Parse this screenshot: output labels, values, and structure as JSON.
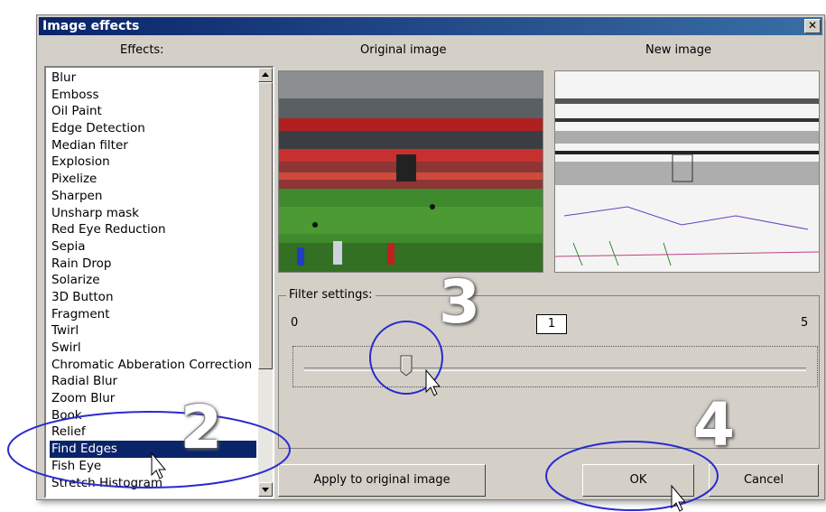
{
  "window": {
    "title": "Image effects"
  },
  "labels": {
    "effects": "Effects:",
    "original": "Original image",
    "new_image": "New image"
  },
  "effects_list": [
    "Blur",
    "Emboss",
    "Oil Paint",
    "Edge Detection",
    "Median filter",
    "Explosion",
    "Pixelize",
    "Sharpen",
    "Unsharp mask",
    "Red Eye Reduction",
    "Sepia",
    "Rain Drop",
    "Solarize",
    "3D Button",
    "Fragment",
    "Twirl",
    "Swirl",
    "Chromatic Abberation Correction",
    "Radial Blur",
    "Zoom Blur",
    "Book",
    "Relief",
    "Find Edges",
    "Fish Eye",
    "Stretch Histogram"
  ],
  "selected_effect": "Find Edges",
  "filter": {
    "legend": "Filter settings:",
    "min": "0",
    "max": "5",
    "value": "1"
  },
  "buttons": {
    "apply": "Apply to original image",
    "ok": "OK",
    "cancel": "Cancel"
  },
  "annotations": {
    "step2": "2",
    "step3": "3",
    "step4": "4"
  },
  "colors": {
    "title_bar": "#0a246a",
    "selection": "#0a246a",
    "annotation_circle": "#2222cc"
  }
}
